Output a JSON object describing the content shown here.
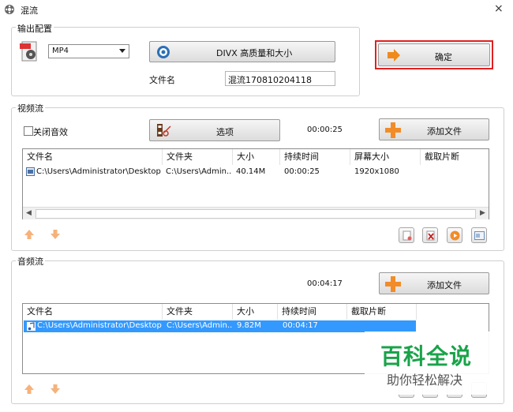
{
  "window": {
    "title": "混流",
    "close": "×"
  },
  "output_config": {
    "legend": "输出配置",
    "format_selected": "MP4",
    "codec_button": "DIVX 高质量和大小",
    "filename_label": "文件名",
    "filename_value": "混流170810204118",
    "confirm_button": "确定"
  },
  "video": {
    "legend": "视频流",
    "mute_label": "关闭音效",
    "options_button": "选项",
    "duration": "00:00:25",
    "add_button": "添加文件",
    "columns": [
      "文件名",
      "文件夹",
      "大小",
      "持续时间",
      "屏幕大小",
      "截取片断"
    ],
    "rows": [
      {
        "name": "C:\\Users\\Administrator\\Desktop\\...",
        "folder": "C:\\Users\\Admin...",
        "size": "40.14M",
        "duration": "00:00:25",
        "screen": "1920x1080",
        "clip": ""
      }
    ]
  },
  "audio": {
    "legend": "音频流",
    "duration": "00:04:17",
    "add_button": "添加文件",
    "columns": [
      "文件名",
      "文件夹",
      "大小",
      "持续时间",
      "截取片断"
    ],
    "rows": [
      {
        "name": "C:\\Users\\Administrator\\Desktop\\...",
        "folder": "C:\\Users\\Admin...",
        "size": "9.82M",
        "duration": "00:04:17",
        "clip": ""
      }
    ]
  },
  "watermark": {
    "line1": "百科全说",
    "line2": "助你轻松解决"
  },
  "colors": {
    "selection": "#3399ff",
    "highlight_border": "#e02020",
    "watermark": "#1aa34a"
  }
}
